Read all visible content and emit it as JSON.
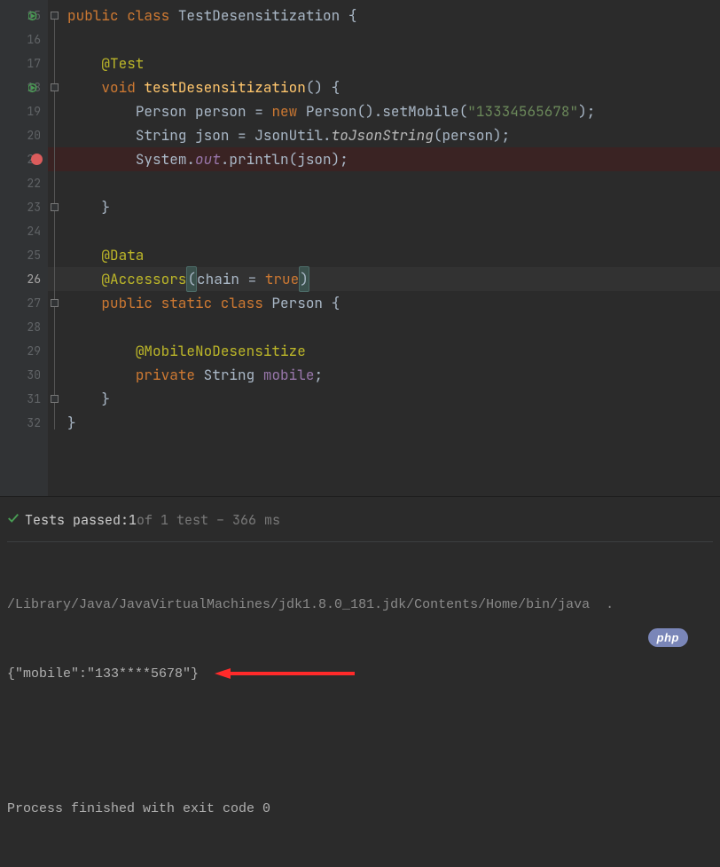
{
  "code": {
    "lines": {
      "l15": {
        "num": "15"
      },
      "l16": {
        "num": "16"
      },
      "l17": {
        "num": "17",
        "ann": "@Test"
      },
      "l18": {
        "num": "18",
        "kw_void": "void",
        "name": "testDesensitization",
        "post": "() {"
      },
      "l19": {
        "num": "19",
        "t1": "Person",
        "v1": "person",
        "eq": " = ",
        "kw_new": "new",
        "t2": "Person",
        "m": ".setMobile(",
        "str": "\"13334565678\"",
        "tail": ");"
      },
      "l20": {
        "num": "20",
        "t1": "String",
        "v1": "json",
        "eq": " = ",
        "cls": "JsonUtil.",
        "sm": "toJsonString",
        "args": "(person);"
      },
      "l21": {
        "num": "21",
        "a": "System.",
        "b": "out",
        "c": ".println(json);"
      },
      "l22": {
        "num": "22"
      },
      "l23": {
        "num": "23",
        "brace": "}"
      },
      "l24": {
        "num": "24"
      },
      "l25": {
        "num": "25",
        "ann": "@Data"
      },
      "l26": {
        "num": "26",
        "ann": "@Accessors",
        "lp": "(",
        "p": "chain = ",
        "v": "true",
        "rp": ")"
      },
      "l27": {
        "num": "27",
        "kw": "public static class",
        "name": "Person",
        "brace": " {"
      },
      "l28": {
        "num": "28"
      },
      "l29": {
        "num": "29",
        "ann": "@MobileNoDesensitize"
      },
      "l30": {
        "num": "30",
        "kw": "private",
        "ty": "String",
        "v": "mobile",
        "tail": ";"
      },
      "l31": {
        "num": "31",
        "brace": "}"
      },
      "l32": {
        "num": "32",
        "brace": "}"
      }
    },
    "class_decl": {
      "kw": "public class",
      "name": "TestDesensitization",
      "brace": " {"
    }
  },
  "run": {
    "status_prefix": "Tests passed: ",
    "status_count": "1",
    "status_dim": " of 1 test – 366 ms",
    "console_path": "/Library/Java/JavaVirtualMachines/jdk1.8.0_181.jdk/Contents/Home/bin/java  .",
    "console_json": "{\"mobile\":\"133****5678\"}",
    "console_exit": "Process finished with exit code 0"
  },
  "badge": {
    "text": "php"
  }
}
